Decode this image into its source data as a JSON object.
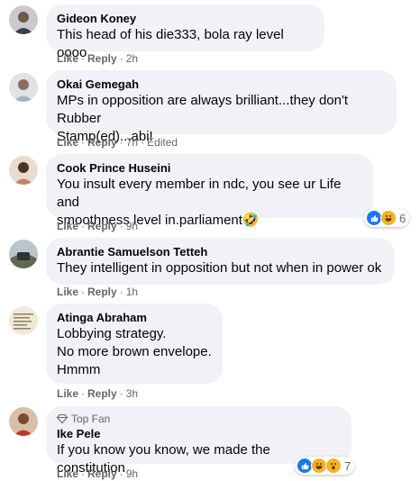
{
  "actions": {
    "like": "Like",
    "reply": "Reply",
    "sep": "·"
  },
  "comments": [
    {
      "author": "Gideon Koney",
      "text": "This head of his die333, bola ray level oooo",
      "time": "2h",
      "edited": ""
    },
    {
      "author": "Okai Gemegah",
      "text": "MPs in opposition are always brilliant...they don't Rubber\nStamp(ed)...abi!",
      "time": "7h",
      "edited": "Edited"
    },
    {
      "author": "Cook Prince Huseini",
      "text": "You insult every member in ndc, you see ur Life and\nsmoothness level in.parliament🤣",
      "time": "9h",
      "edited": "",
      "reactions": {
        "icons": [
          "like-reaction-icon",
          "haha-reaction-icon"
        ],
        "count": "6"
      }
    },
    {
      "author": "Abrantie Samuelson Tetteh",
      "text": "They intelligent in opposition but not when in power ok",
      "time": "1h",
      "edited": ""
    },
    {
      "author": "Atinga Abraham",
      "text": "Lobbying strategy.\nNo more brown envelope.\nHmmm",
      "time": "3h",
      "edited": ""
    },
    {
      "badge": "Top Fan",
      "author": "Ike Pele",
      "text": "If you know you know, we made the constitution",
      "time": "9h",
      "edited": "",
      "reactions": {
        "icons": [
          "like-reaction-icon",
          "haha-reaction-icon",
          "wow-reaction-icon"
        ],
        "count": "7"
      }
    }
  ],
  "colors": {
    "bubble": "#f0f2f5",
    "meta": "#65676b",
    "like": "#1877f2",
    "haha": "#f7b125"
  }
}
